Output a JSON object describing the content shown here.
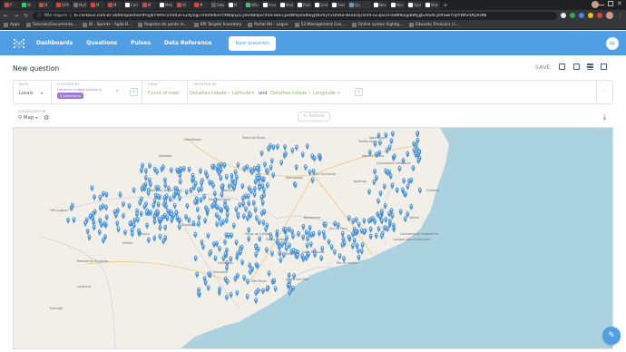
{
  "browser": {
    "tabs": [
      {
        "title": "P",
        "color": "#e94235"
      },
      {
        "title": "W",
        "color": "#25d366"
      },
      {
        "title": "M",
        "color": "#e94235"
      },
      {
        "title": "Differ",
        "color": "#e94235"
      },
      {
        "title": "MySQ",
        "color": "#777777"
      },
      {
        "title": "M",
        "color": "#e94235"
      },
      {
        "title": "M",
        "color": "#e94235"
      },
      {
        "title": "Com",
        "color": "#ffffff"
      },
      {
        "title": "M",
        "color": "#e94235"
      },
      {
        "title": "Melan",
        "color": "#ffffff"
      },
      {
        "title": "ID",
        "color": "#e94235"
      },
      {
        "title": "M",
        "color": "#e94235"
      },
      {
        "title": "Vwor",
        "color": "#5f6368"
      },
      {
        "title": "M",
        "color": "#ffffff"
      },
      {
        "title": "Whats",
        "color": "#25d366"
      },
      {
        "title": "Insert",
        "color": "#ffffff"
      },
      {
        "title": "Mode",
        "color": "#ffffff"
      },
      {
        "title": "Relatório",
        "color": "#ffffff"
      },
      {
        "title": "Gmb",
        "color": "#ffffff"
      },
      {
        "title": "Relat",
        "color": "#ffffff"
      },
      {
        "title": "Qu",
        "color": "#509ee3"
      },
      {
        "title": "Nexte",
        "color": "#ffffff"
      },
      {
        "title": "Noval",
        "color": "#ffffff"
      },
      {
        "title": "Ajustes",
        "color": "#ffffff"
      },
      {
        "title": "Mate",
        "color": "#ffffff"
      }
    ],
    "active_tab_index": 20,
    "not_secure": "Não seguro",
    "url": "bi.clickbus.com.br:3000/question#eyJkYXRhc2V0X3F1ZXJ5Ijp7ImRhdGFiYXNlIjoyLCJ0eXBlIjoicXVlcnkiLCJxdWVyeSI6eyJzb3VyY2UtdGFibGUiOjcsImFnZ3JlZ2F0aW9uIjpbWyJjb3VudCJdXSwiYnJlYWtvdXQiOltb",
    "bookmarks": [
      "Apps",
      "Tutoriais/Documenta...",
      "BI - Sprints - Agile B...",
      "Registro de ponto m...",
      "KPI Targets Inventory",
      "Portal RH - Logon",
      "53 Management Con...",
      "Online syntax highlig...",
      "Eduardo Trevisani | L..."
    ]
  },
  "nav": {
    "links": [
      "Dashboards",
      "Questions",
      "Pulses",
      "Data Reference"
    ],
    "new_question": "New question",
    "user_initials": "LL"
  },
  "header": {
    "title": "New question",
    "save": "SAVE"
  },
  "query": {
    "data_label": "DATA",
    "data_value": "Locals",
    "filtered_label": "FILTERED BY",
    "filter_field": "Detalhes cidade",
    "filter_op": "Estado is",
    "filter_pill": "2 selections",
    "view_label": "VIEW",
    "view_value": "Count of rows",
    "grouped_label": "GROUPED BY",
    "group_1_table": "Detalhes cidade",
    "group_1_field": "Latitude",
    "group_and": "and",
    "group_2_table": "Detalhes cidade",
    "group_2_field": "Longitude",
    "more": "···"
  },
  "visualization": {
    "label": "VISUALIZATION",
    "type": "Map",
    "refresh": "Refresh"
  },
  "map": {
    "sea_color": "#aad3df",
    "land_color": "#f2efe9",
    "pin_color": "#509ee3",
    "cities": [
      "Uberlândia",
      "Patos de Minas",
      "Montes Claros",
      "Teófilo Otoni",
      "Governador Valadares",
      "Uberaba",
      "Divinópolis",
      "Belo Horizonte",
      "Ipatinga",
      "Colatina",
      "Barbacena",
      "Juiz de Fora",
      "Campos dos Goytacazes",
      "Três Lagoas",
      "Presidente Prudente",
      "São José do Rio Preto",
      "Ribeirão Preto",
      "Bauru",
      "Londrina",
      "Maringá",
      "Campinas",
      "São Paulo",
      "Sorocaba",
      "Rio de Janeiro",
      "Angra dos Reis",
      "Vitória",
      "Poços de Caldas",
      "Pouso Alegre",
      "Resende",
      "Santos",
      "Volta Redonda",
      "Franca",
      "Araraquara",
      "Marília",
      "Itapetinga",
      "Cachoeiro de Itapemirim"
    ]
  }
}
